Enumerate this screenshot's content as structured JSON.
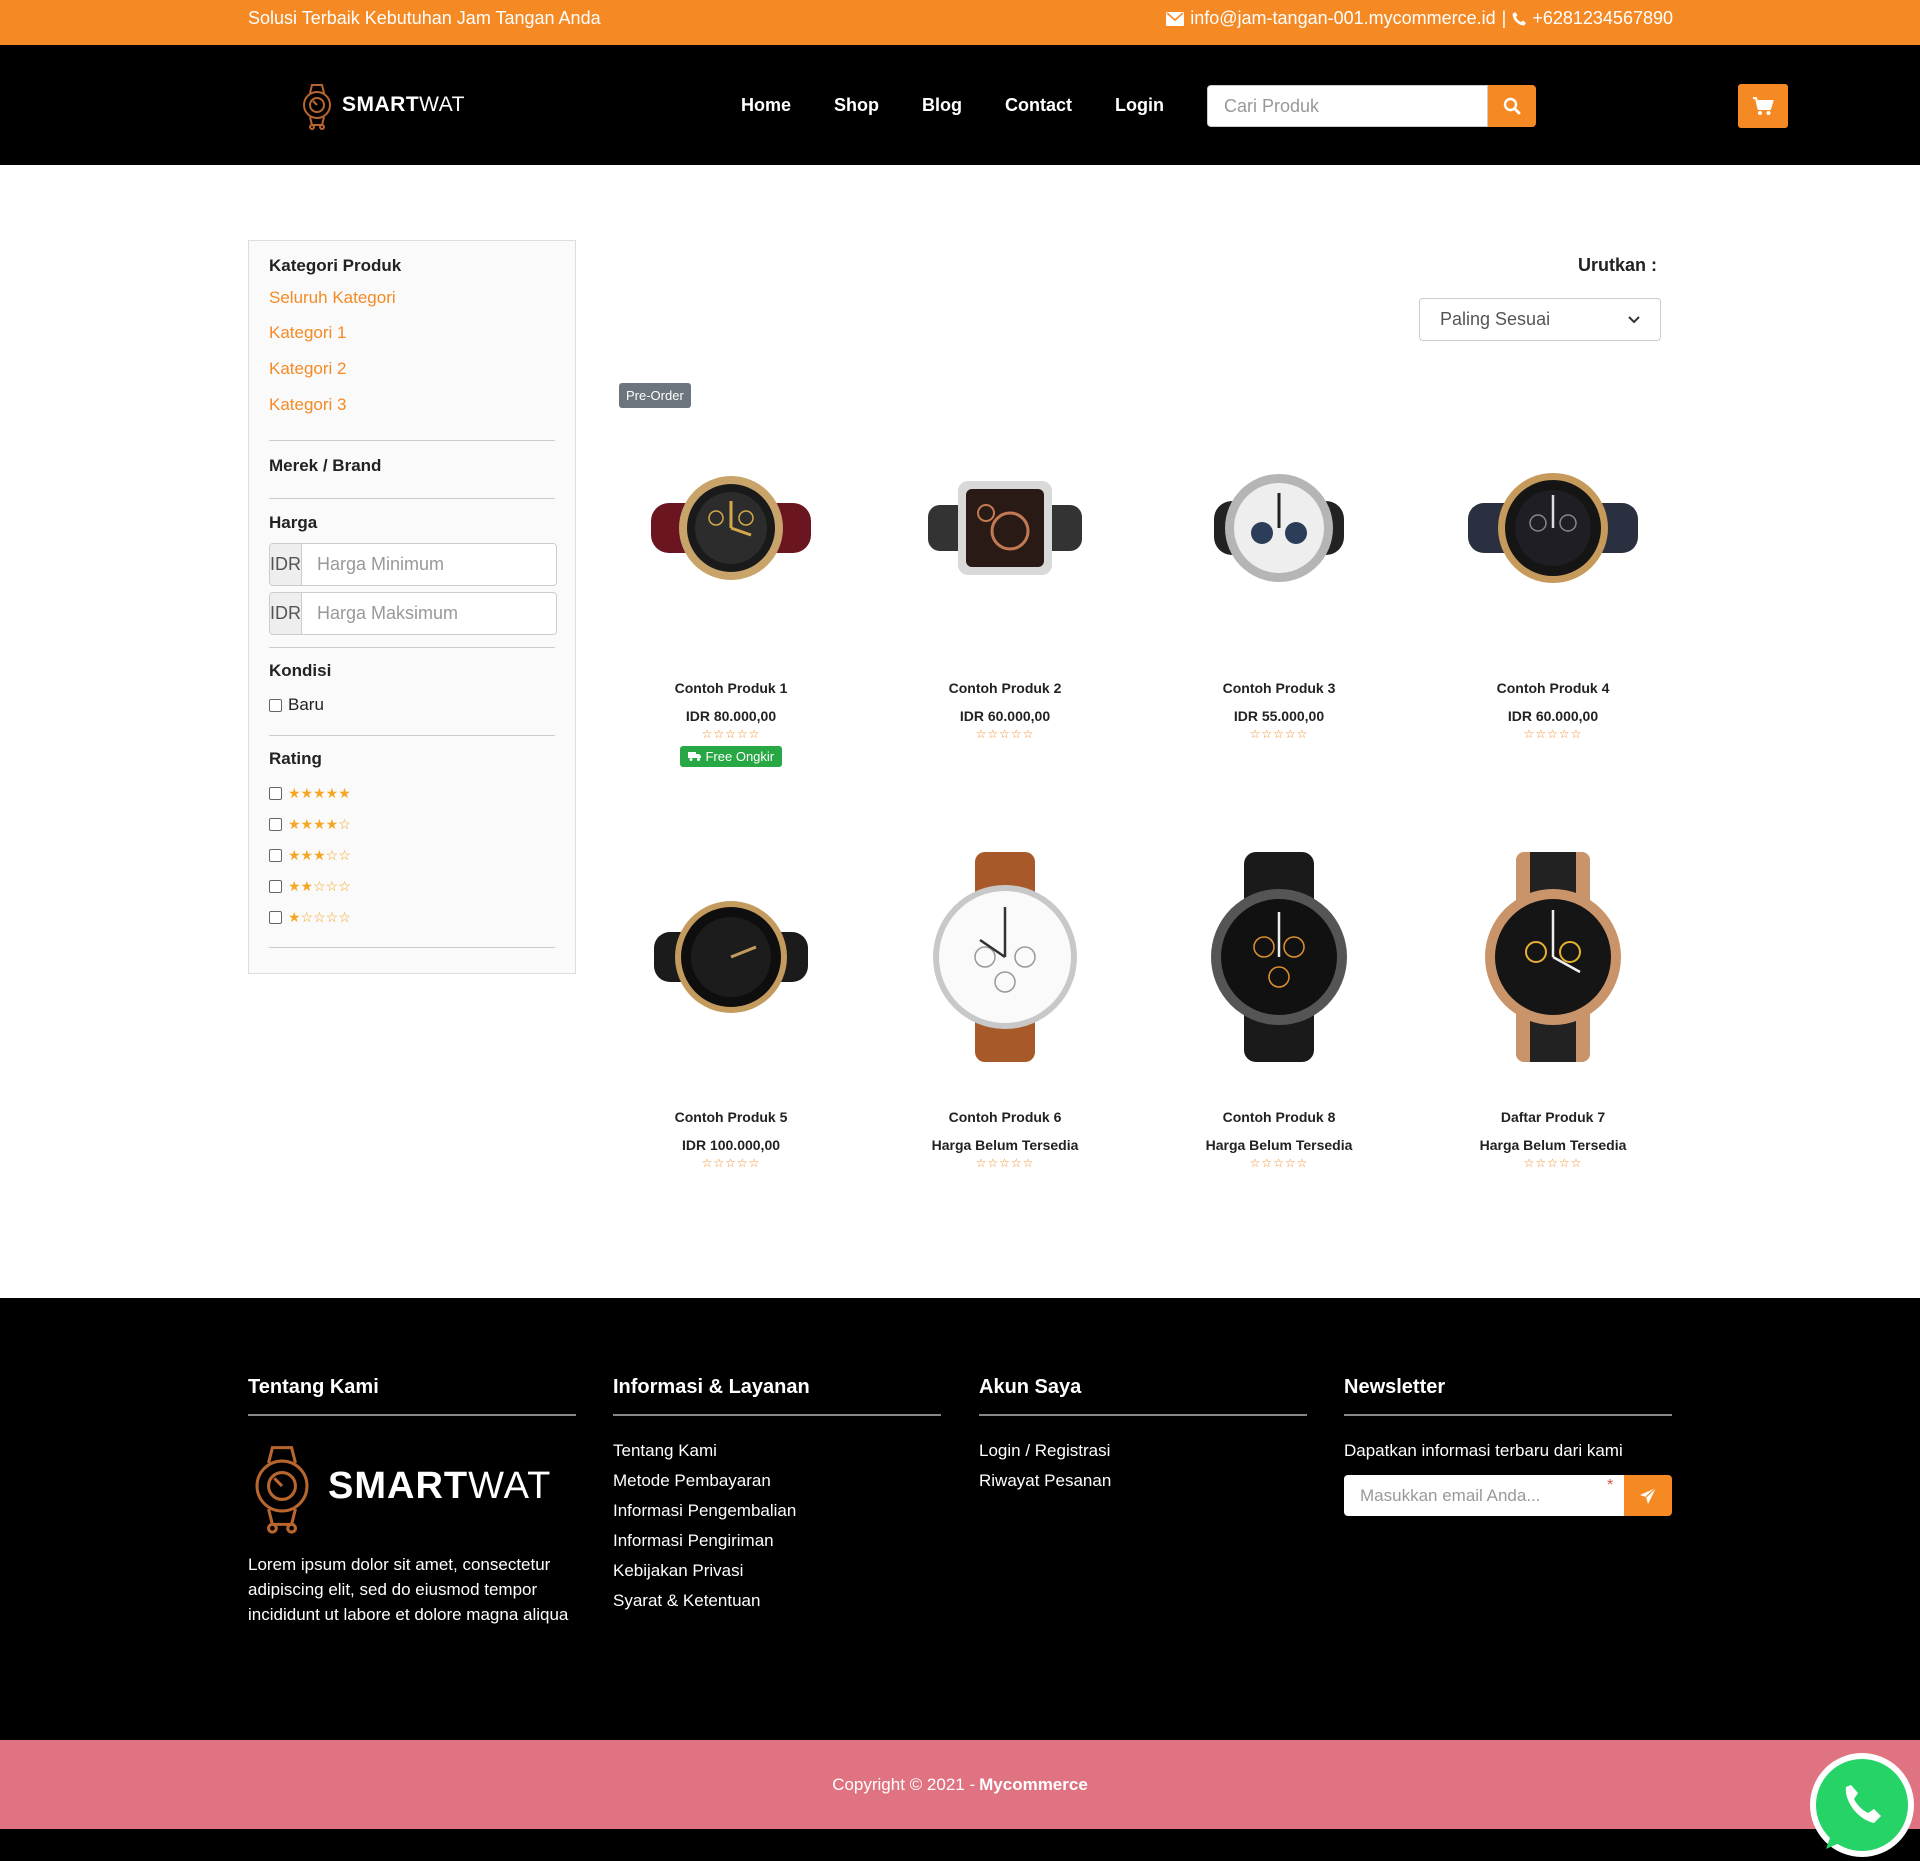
{
  "topbar": {
    "tagline": "Solusi Terbaik Kebutuhan Jam Tangan Anda",
    "email": "info@jam-tangan-001.mycommerce.id",
    "separator": "|",
    "phone": "+6281234567890"
  },
  "brand": {
    "name_bold": "SMART",
    "name_light": "WAT"
  },
  "nav": {
    "home": "Home",
    "shop": "Shop",
    "blog": "Blog",
    "contact": "Contact",
    "login": "Login"
  },
  "search": {
    "placeholder": "Cari Produk"
  },
  "sidebar": {
    "category_title": "Kategori Produk",
    "categories": [
      "Seluruh Kategori",
      "Kategori 1",
      "Kategori 2",
      "Kategori 3"
    ],
    "brand_title": "Merek / Brand",
    "price_title": "Harga",
    "currency": "IDR",
    "min_placeholder": "Harga Minimum",
    "max_placeholder": "Harga Maksimum",
    "condition_title": "Kondisi",
    "condition_new": "Baru",
    "rating_title": "Rating",
    "ratings": [
      "★★★★★",
      "★★★★☆",
      "★★★☆☆",
      "★★☆☆☆",
      "★☆☆☆☆"
    ]
  },
  "sort": {
    "label": "Urutkan :",
    "selected": "Paling Sesuai"
  },
  "badges": {
    "preorder": "Pre-Order",
    "free_shipping": "Free Ongkir"
  },
  "products": [
    {
      "name": "Contoh Produk 1",
      "price": "IDR 80.000,00",
      "rating": "☆☆☆☆☆"
    },
    {
      "name": "Contoh Produk 2",
      "price": "IDR 60.000,00",
      "rating": "☆☆☆☆☆"
    },
    {
      "name": "Contoh Produk 3",
      "price": "IDR 55.000,00",
      "rating": "☆☆☆☆☆"
    },
    {
      "name": "Contoh Produk 4",
      "price": "IDR 60.000,00",
      "rating": "☆☆☆☆☆"
    },
    {
      "name": "Contoh Produk 5",
      "price": "IDR 100.000,00",
      "rating": "☆☆☆☆☆"
    },
    {
      "name": "Contoh Produk 6",
      "price": "Harga Belum Tersedia",
      "rating": "☆☆☆☆☆"
    },
    {
      "name": "Contoh Produk 8",
      "price": "Harga Belum Tersedia",
      "rating": "☆☆☆☆☆"
    },
    {
      "name": "Daftar Produk 7",
      "price": "Harga Belum Tersedia",
      "rating": "☆☆☆☆☆"
    }
  ],
  "footer": {
    "about_title": "Tentang Kami",
    "about_text": "Lorem ipsum dolor sit amet, consectetur adipiscing elit, sed do eiusmod tempor incididunt ut labore et dolore magna aliqua",
    "info_title": "Informasi & Layanan",
    "info_links": [
      "Tentang Kami",
      "Metode Pembayaran",
      "Informasi Pengembalian",
      "Informasi Pengiriman",
      "Kebijakan Privasi",
      "Syarat & Ketentuan"
    ],
    "account_title": "Akun Saya",
    "account_links": [
      "Login / Registrasi",
      "Riwayat Pesanan"
    ],
    "newsletter_title": "Newsletter",
    "newsletter_text": "Dapatkan informasi terbaru dari kami",
    "newsletter_placeholder": "Masukkan email Anda...",
    "required_mark": "*"
  },
  "copyright": {
    "text": "Copyright © 2021 -",
    "brand": "Mycommerce"
  },
  "colors": {
    "accent": "#f58a25",
    "footer_bar": "#e07381",
    "free_shipping": "#28a745",
    "whatsapp": "#25d366"
  },
  "icons": [
    "envelope-icon",
    "phone-icon",
    "search-icon",
    "cart-icon",
    "truck-icon",
    "send-icon",
    "whatsapp-icon"
  ]
}
